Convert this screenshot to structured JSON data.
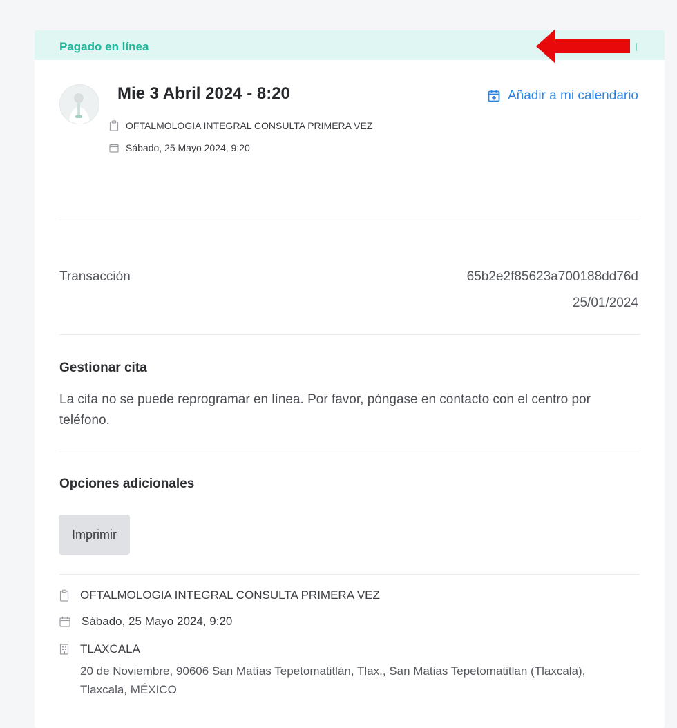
{
  "status": {
    "label": "Pagado en línea"
  },
  "appointment": {
    "title": "Mie 3 Abril 2024 - 8:20",
    "add_to_calendar": "Añadir a mi calendario",
    "service": "OFTALMOLOGIA INTEGRAL CONSULTA PRIMERA VEZ",
    "datetime": "Sábado, 25 Mayo 2024, 9:20"
  },
  "transaction": {
    "label": "Transacción",
    "id": "65b2e2f85623a700188dd76d",
    "date": "25/01/2024"
  },
  "manage": {
    "title": "Gestionar cita",
    "text": "La cita no se puede reprogramar en línea. Por favor, póngase en contacto con el centro por teléfono."
  },
  "options": {
    "title": "Opciones adicionales",
    "print_label": "Imprimir"
  },
  "details": {
    "service": "OFTALMOLOGIA INTEGRAL CONSULTA PRIMERA VEZ",
    "datetime": "Sábado, 25 Mayo 2024, 9:20",
    "center_name": "TLAXCALA",
    "address": "20 de Noviembre, 90606 San Matías Tepetomatitlán, Tlax., San Matias Tepetomatitlan (Tlaxcala), Tlaxcala, MÉXICO"
  },
  "icons": {
    "calendar_add": "calendar-plus-icon",
    "clipboard": "clipboard-icon",
    "calendar": "calendar-icon",
    "building": "building-icon",
    "annotation_arrow": "arrow-left-icon"
  },
  "colors": {
    "status_bg": "#dff6f2",
    "status_text": "#1fb89b",
    "link": "#2b86e6",
    "annotation": "#e8090b"
  }
}
